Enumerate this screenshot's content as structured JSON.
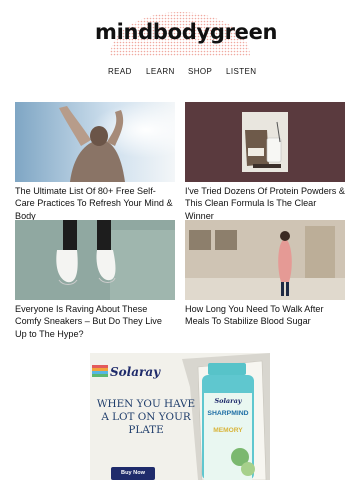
{
  "brand": {
    "logo_text": "mindbodygreen"
  },
  "nav": {
    "items": [
      "READ",
      "LEARN",
      "SHOP",
      "LISTEN"
    ]
  },
  "articles": [
    {
      "title": "The Ultimate List Of 80+ Free Self-Care Practices To Refresh Your Mind & Body"
    },
    {
      "title": "I've Tried Dozens Of Protein Powders & This Clean Formula Is The Clear Winner"
    },
    {
      "title": "Everyone Is Raving About These Comfy Sneakers – But Do They Live Up to The Hype?"
    },
    {
      "title": "How Long You Need To Walk After Meals To Stabilize Blood Sugar"
    }
  ],
  "ad": {
    "brand": "Solaray",
    "headline": "WHEN YOU HAVE A LOT ON YOUR PLATE",
    "cta": "Buy Now",
    "product_brand": "Solaray",
    "product_name": "SHARPMIND",
    "product_variant": "MEMORY"
  },
  "colors": {
    "logo_dots": "#f0a9a0",
    "ad_button": "#1f2b6b",
    "accent_maroon": "#5a3a3e"
  }
}
